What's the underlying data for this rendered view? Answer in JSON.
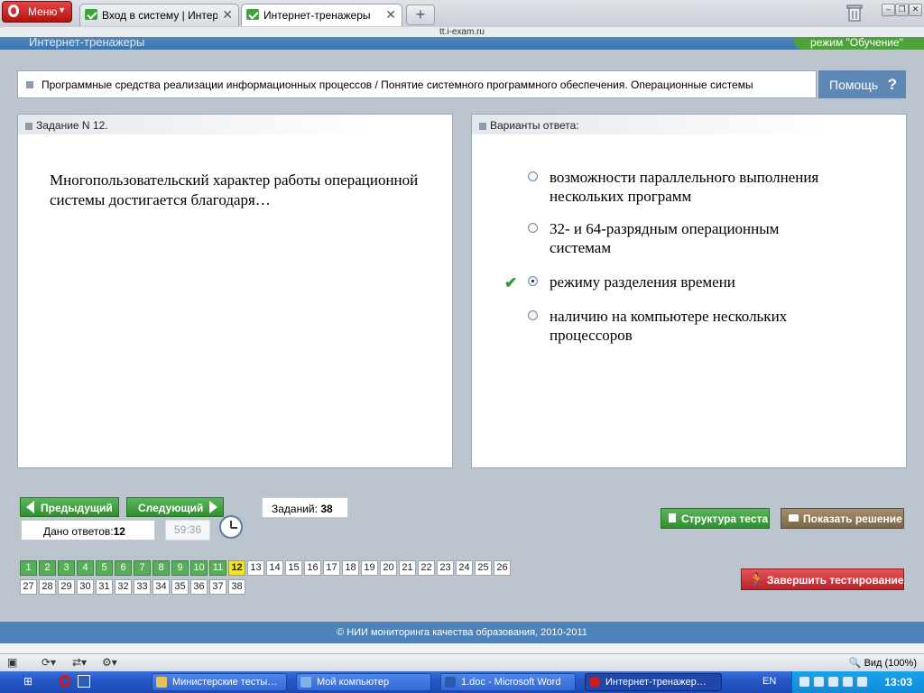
{
  "browser": {
    "menu_label": "Меню",
    "tabs": [
      {
        "label": "Вход в систему | Интер…",
        "active": false
      },
      {
        "label": "Интернет-тренажеры",
        "active": true
      }
    ],
    "address": "tt.i-exam.ru"
  },
  "site": {
    "title": "Интернет-тренажеры",
    "mode": "режим \"Обучение\""
  },
  "topic": "Программные средства реализации информационных процессов / Понятие системного программного обеспечения. Операционные системы",
  "help_label": "Помощь",
  "help_icon": "?",
  "question": {
    "header": "Задание N 12.",
    "text": "Многопользовательский характер работы операционной системы достигается благодаря…"
  },
  "answers": {
    "header": "Варианты ответа:",
    "options": [
      {
        "text": "возможности параллельного выполнения нескольких программ",
        "selected": false,
        "correct": false
      },
      {
        "text": "32- и 64-разрядным операционным системам",
        "selected": false,
        "correct": false
      },
      {
        "text": "режиму разделения времени",
        "selected": true,
        "correct": true
      },
      {
        "text": "наличию на компьютере нескольких процессоров",
        "selected": false,
        "correct": false
      }
    ]
  },
  "nav": {
    "prev_label": "Предыдущий",
    "next_label": "Следующий",
    "answered_label": "Дано ответов:",
    "answered_count": "12",
    "timer": "59:36",
    "tasks_label": "Заданий:",
    "tasks_count": "38",
    "structure_label": "Структура теста",
    "solution_label": "Показать решение",
    "finish_label": "Завершить тестирование"
  },
  "grid": {
    "total": 38,
    "answered": 11,
    "current": 12,
    "per_row": 26
  },
  "footer": "© НИИ мониторинга качества образования, 2010-2011",
  "statusbar": {
    "zoom": "Вид (100%)"
  },
  "taskbar": {
    "items": [
      {
        "label": "Министерские тесты…"
      },
      {
        "label": "Мой компьютер"
      },
      {
        "label": "1.doc - Microsoft Word"
      },
      {
        "label": "Интернет-тренажер…"
      }
    ],
    "lang": "EN",
    "time": "13:03"
  },
  "colors": {
    "header_blue": "#4d83b8",
    "answered_green": "#58ad58",
    "current_yellow": "#f3e22a",
    "finish_red": "#c9313a"
  }
}
